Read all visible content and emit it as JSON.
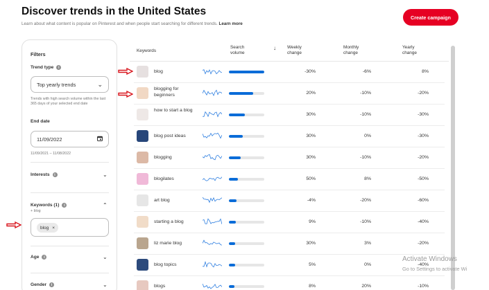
{
  "header": {
    "title": "Discover trends in the United States",
    "subtitle": "Learn about what content is popular on Pinterest and when people start searching for different trends.",
    "learn_more": "Learn more",
    "create_button": "Create campaign"
  },
  "filters": {
    "title": "Filters",
    "trend_type_label": "Trend type",
    "trend_type_value": "Top yearly trends",
    "trend_note": "Trends with high search volume within the last 365 days of your selected end date",
    "end_date_label": "End date",
    "end_date_value": "11/09/2022",
    "date_range": "11/09/2021 – 11/08/2022",
    "interests_label": "Interests",
    "keywords_label": "Keywords (1)",
    "keywords_sub": "+ blog",
    "chip": "blog",
    "chip_remove": "×",
    "age_label": "Age",
    "gender_label": "Gender"
  },
  "table": {
    "headers": {
      "keywords": "Keywords",
      "search_volume_line1": "Search",
      "search_volume_line2": "volume",
      "sort_icon": "↓",
      "weekly_line1": "Weekly",
      "weekly_line2": "change",
      "monthly_line1": "Monthly",
      "monthly_line2": "change",
      "yearly_line1": "Yearly",
      "yearly_line2": "change"
    },
    "rows": [
      {
        "keyword": "blog",
        "volume": 1.0,
        "weekly": "-30%",
        "monthly": "-6%",
        "yearly": "8%",
        "thumb": "#e6e0e0"
      },
      {
        "keyword": "blogging for beginners",
        "volume": 0.68,
        "weekly": "20%",
        "monthly": "-10%",
        "yearly": "-20%",
        "thumb": "#f1d8c4"
      },
      {
        "keyword": "how to start a blog",
        "volume": 0.46,
        "weekly": "30%",
        "monthly": "-10%",
        "yearly": "-30%",
        "thumb": "#eee8e6"
      },
      {
        "keyword": "blog post ideas",
        "volume": 0.4,
        "weekly": "30%",
        "monthly": "0%",
        "yearly": "-30%",
        "thumb": "#27467a"
      },
      {
        "keyword": "blogging",
        "volume": 0.34,
        "weekly": "30%",
        "monthly": "-10%",
        "yearly": "-20%",
        "thumb": "#dcb9a6"
      },
      {
        "keyword": "blogilates",
        "volume": 0.26,
        "weekly": "50%",
        "monthly": "8%",
        "yearly": "-50%",
        "thumb": "#f0b9d8"
      },
      {
        "keyword": "art blog",
        "volume": 0.22,
        "weekly": "-4%",
        "monthly": "-20%",
        "yearly": "-60%",
        "thumb": "#e6e6e6"
      },
      {
        "keyword": "starting a blog",
        "volume": 0.2,
        "weekly": "9%",
        "monthly": "-10%",
        "yearly": "-40%",
        "thumb": "#f1dcc8"
      },
      {
        "keyword": "liz marie blog",
        "volume": 0.18,
        "weekly": "30%",
        "monthly": "3%",
        "yearly": "-20%",
        "thumb": "#b9a58e"
      },
      {
        "keyword": "blog topics",
        "volume": 0.18,
        "weekly": "5%",
        "monthly": "0%",
        "yearly": "-40%",
        "thumb": "#2c4a7c"
      },
      {
        "keyword": "blogs",
        "volume": 0.16,
        "weekly": "8%",
        "monthly": "20%",
        "yearly": "-10%",
        "thumb": "#e7c9c0"
      }
    ]
  },
  "overlay": {
    "activate_title": "Activate Windows",
    "activate_sub": "Go to Settings to activate Wi"
  },
  "colors": {
    "brand_red": "#e60023",
    "bar_blue": "#0a6cd8",
    "arrow_red": "#d8141c"
  }
}
